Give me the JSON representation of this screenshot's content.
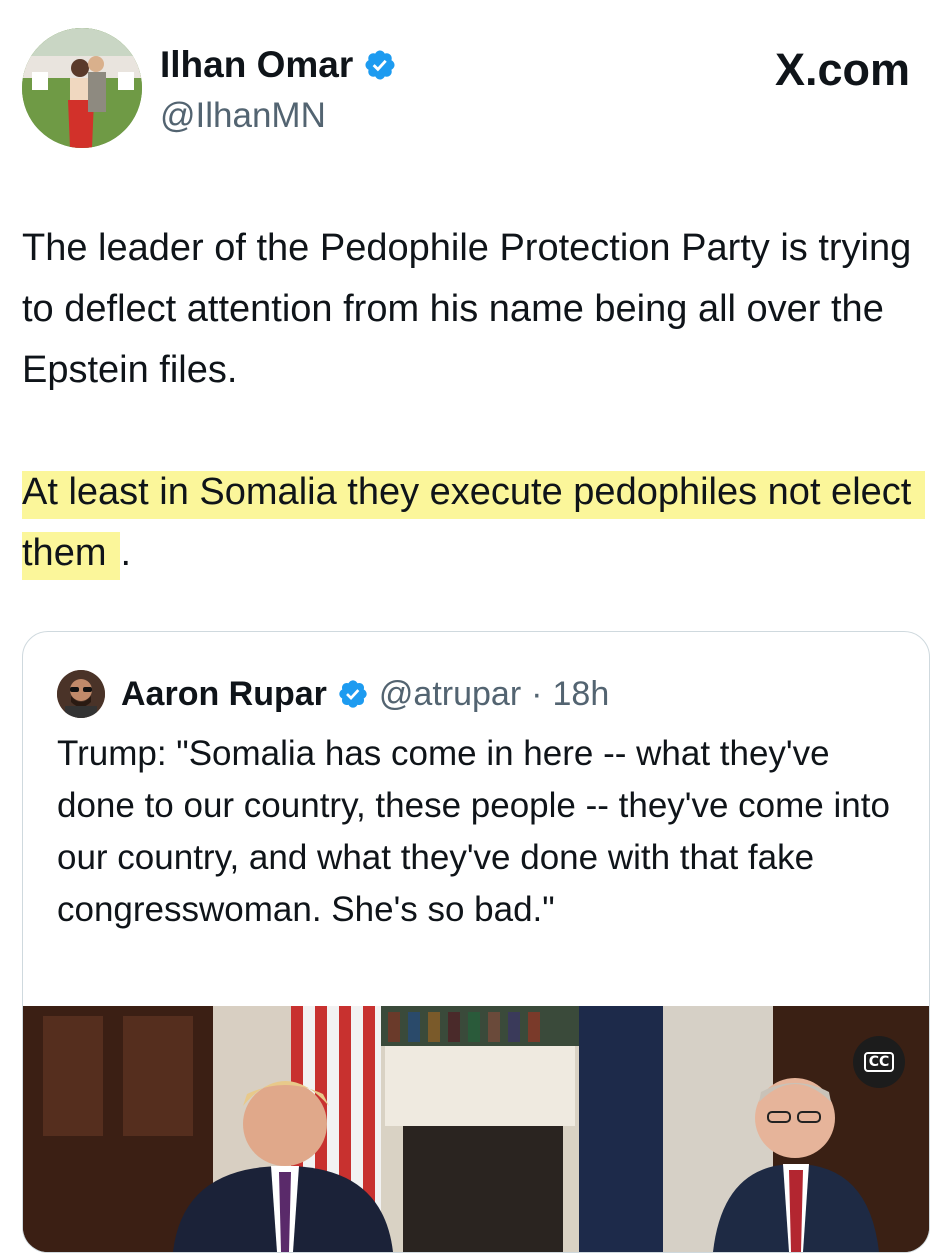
{
  "post": {
    "author_name": "Ilhan Omar",
    "author_handle": "@IlhanMN",
    "brand": "X.com",
    "paragraph1": "The leader of the Pedophile Protection Party is trying to deflect attention from his name being all over the Epstein files.",
    "paragraph2": "At least in Somalia they execute pedophiles not elect them",
    "paragraph2_end": "."
  },
  "quote": {
    "author_name": "Aaron Rupar",
    "author_handle": "@atrupar",
    "separator": "·",
    "time": "18h",
    "text": "Trump: \"Somalia has come in here -- what they've done to our country, these people -- they've come into our country, and what they've done with that fake congresswoman. She's so bad.\""
  },
  "video": {
    "cc_label": "CC"
  },
  "icons": {
    "verified": "verified-badge-icon",
    "captions": "closed-captions-icon"
  },
  "colors": {
    "verified_blue": "#1d9bf0",
    "highlight": "#fbf69a",
    "secondary_text": "#536471"
  }
}
